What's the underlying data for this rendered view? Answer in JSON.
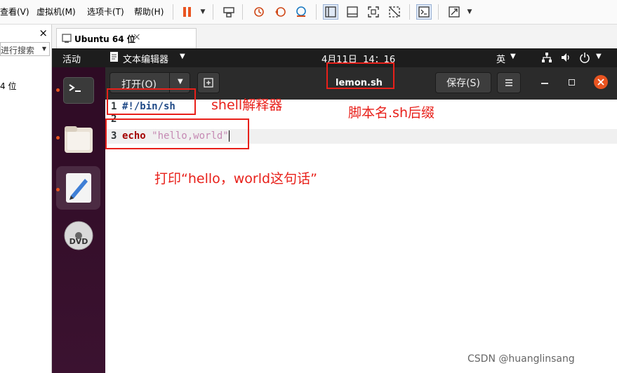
{
  "vmware": {
    "menus": [
      "查看(V)",
      "虚拟机(M)",
      "选项卡(T)",
      "帮助(H)"
    ],
    "library": {
      "search_placeholder": "进行搜索",
      "vm_item": "4 位"
    },
    "tab_title": "Ubuntu 64 位",
    "close_glyph": "×"
  },
  "ubuntu": {
    "activities": "活动",
    "app_menu": "文本编辑器",
    "clock": "4月11日  14：16",
    "input_method": "英"
  },
  "gedit": {
    "open_button": "打开(O)",
    "file_name": "lemon.sh",
    "save_button": "保存(S)",
    "lines": [
      {
        "number": "1",
        "text": "#!/bin/sh"
      },
      {
        "number": "2",
        "text": ""
      },
      {
        "number": "3",
        "keyword": "echo",
        "string": "\"hello,world\""
      }
    ]
  },
  "annotations": {
    "shell_note": "shell解释器",
    "filename_note": "脚本名.sh后缀",
    "echo_note": "打印“hello，world这句话”"
  },
  "watermark": "CSDN @huanglinsang",
  "colors": {
    "ubuntu_orange": "#e95420",
    "annotation_red": "#e8201a",
    "string_purple": "#c589b3",
    "keyword_red": "#a40000",
    "shebang_blue": "#204a87"
  }
}
